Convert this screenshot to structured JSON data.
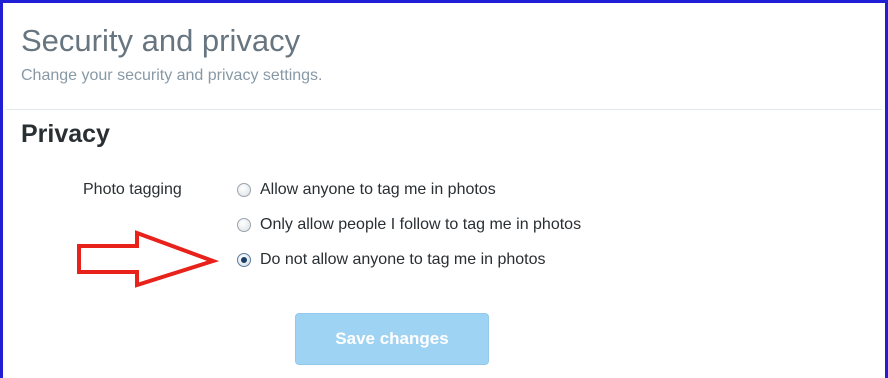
{
  "header": {
    "title": "Security and privacy",
    "subtitle": "Change your security and privacy settings."
  },
  "privacy": {
    "section_title": "Privacy",
    "photo_tagging": {
      "label": "Photo tagging",
      "options": [
        {
          "label": "Allow anyone to tag me in photos",
          "checked": false
        },
        {
          "label": "Only allow people I follow to tag me in photos",
          "checked": false
        },
        {
          "label": "Do not allow anyone to tag me in photos",
          "checked": true
        }
      ]
    }
  },
  "actions": {
    "save_label": "Save changes"
  },
  "annotation": {
    "arrow_icon": "red-outline-arrow-icon",
    "arrow_color": "#e8221b"
  },
  "colors": {
    "frame_border": "#1f1fd6",
    "button_bg": "#9fd3f4",
    "title_text": "#66757f"
  }
}
